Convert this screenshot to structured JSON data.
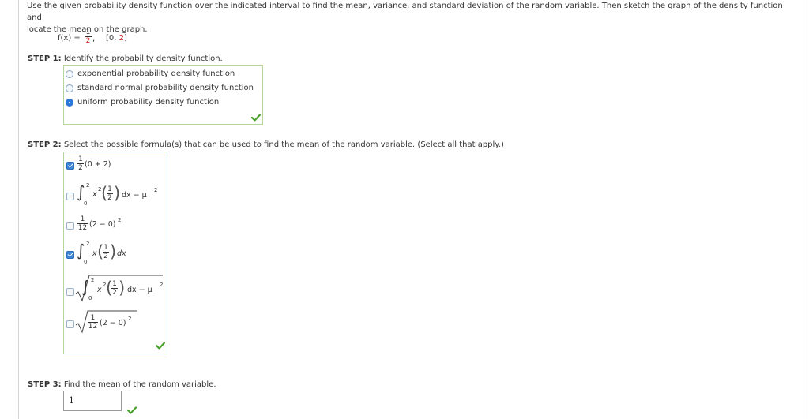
{
  "instructions": "Use the given probability density function over the indicated interval to find the mean, variance, and standard deviation of the random variable. Then sketch the graph of the density function and locate the mean on the graph.",
  "instructions_line1": "Use the given probability density function over the indicated interval to find the mean, variance, and standard deviation of the random variable. Then sketch the graph of the density function and",
  "instructions_line2": "locate the mean on the graph.",
  "function": {
    "lhs": "f(x) =",
    "numerator": "1",
    "denominator": "2",
    "comma": ",",
    "interval_open": "[0,",
    "interval_value": "2",
    "interval_close": "]"
  },
  "step1": {
    "label": "STEP 1:",
    "prompt": "Identify the probability density function.",
    "options": [
      {
        "label": "exponential probability density function",
        "selected": false
      },
      {
        "label": "standard normal probability density function",
        "selected": false
      },
      {
        "label": "uniform probability density function",
        "selected": true
      }
    ],
    "status": "correct"
  },
  "step2": {
    "label": "STEP 2:",
    "prompt": "Select the possible formula(s) that can be used to find the mean of the random variable. (Select all that apply.)",
    "options": [
      {
        "id": "half-times-sum",
        "checked": true
      },
      {
        "id": "integral-x2-minus-mu2",
        "checked": false
      },
      {
        "id": "one-twelfth-diff-squared",
        "checked": false
      },
      {
        "id": "integral-x-times-half",
        "checked": true
      },
      {
        "id": "sqrt-integral-x2-minus-mu2",
        "checked": false
      },
      {
        "id": "sqrt-one-twelfth-diff-squared",
        "checked": false
      }
    ],
    "math": {
      "half": {
        "num": "1",
        "den": "2"
      },
      "twelfth": {
        "num": "1",
        "den": "12"
      },
      "sum": "(0 + 2)",
      "diff_sq": "(2 − 0)",
      "sq": "2",
      "integral": "∫",
      "upper": "2",
      "lower": "0",
      "x2": "x",
      "x": "x",
      "dx": "dx",
      "minus_mu": "dx − μ",
      "mu_exp": "2"
    },
    "status": "correct"
  },
  "step3": {
    "label": "STEP 3:",
    "prompt": "Find the mean of the random variable.",
    "answer": "1",
    "status": "correct"
  }
}
